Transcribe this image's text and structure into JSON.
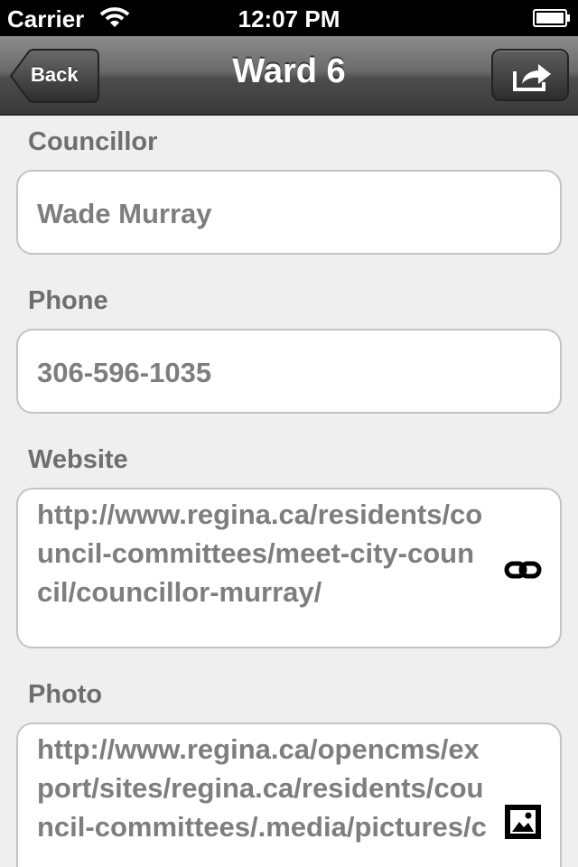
{
  "status_bar": {
    "carrier": "Carrier",
    "time": "12:07 PM"
  },
  "nav": {
    "back_label": "Back",
    "title": "Ward 6",
    "share_icon": "share-icon"
  },
  "fields": {
    "councillor": {
      "label": "Councillor",
      "value": "Wade Murray"
    },
    "phone": {
      "label": "Phone",
      "value": "306-596-1035"
    },
    "website": {
      "label": "Website",
      "value": "http://www.regina.ca/residents/council-committees/meet-city-council/councillor-murray/",
      "icon": "link-icon"
    },
    "photo": {
      "label": "Photo",
      "value": "http://www.regina.ca/opencms/export/sites/regina.ca/residents/council-committees/.media/pictures/c",
      "icon": "image-icon"
    }
  },
  "colors": {
    "background": "#efefef",
    "label": "#6e6e6e",
    "value": "#7e7e7e",
    "nav_top": "#8c8c8c",
    "nav_bottom": "#3a3a3a"
  }
}
